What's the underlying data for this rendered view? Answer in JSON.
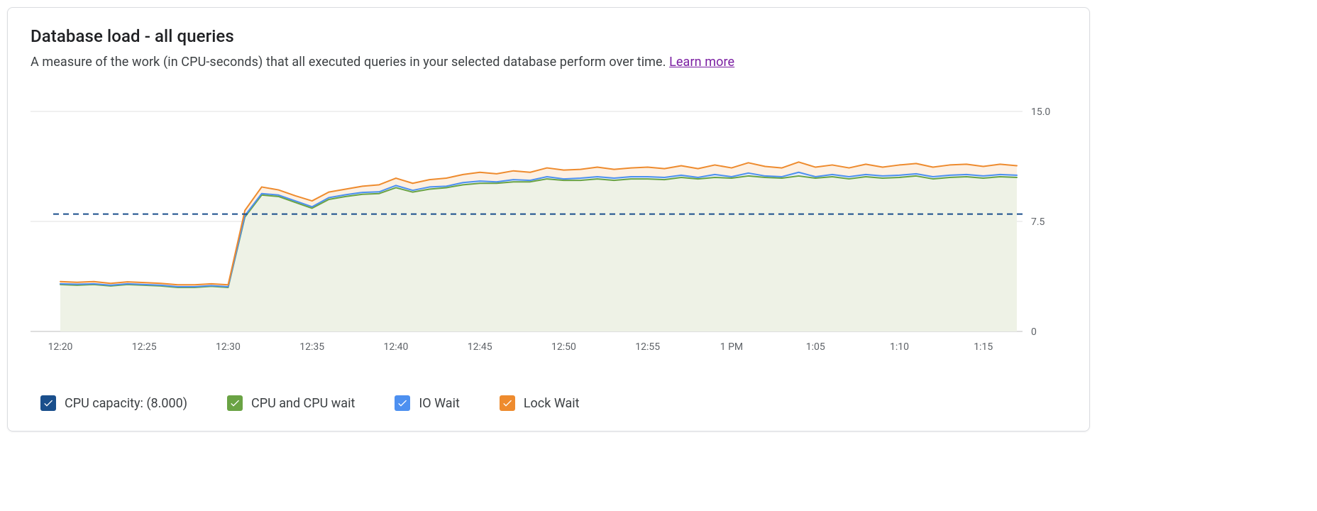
{
  "header": {
    "title": "Database load - all queries",
    "subtitle_pre": "A measure of the work (in CPU-seconds) that all executed queries in your selected database perform over time. ",
    "learn_more": "Learn more"
  },
  "legend": {
    "cpu_capacity": {
      "label": "CPU capacity: (8.000)",
      "color": "#1a4f8c"
    },
    "cpu_wait": {
      "label": "CPU and CPU wait",
      "color": "#6aa344"
    },
    "io_wait": {
      "label": "IO Wait",
      "color": "#4d90f0"
    },
    "lock_wait": {
      "label": "Lock Wait",
      "color": "#ee8b2e"
    }
  },
  "chart_data": {
    "type": "area",
    "ylabel": "",
    "xlabel": "",
    "ylim": [
      0,
      15.0
    ],
    "y_ticks": [
      "0",
      "7.5",
      "15.0"
    ],
    "x_ticks": [
      "12:20",
      "12:25",
      "12:30",
      "12:35",
      "12:40",
      "12:45",
      "12:50",
      "12:55",
      "1 PM",
      "1:05",
      "1:10",
      "1:15"
    ],
    "cpu_capacity_line": 8.0,
    "x": [
      0,
      1,
      2,
      3,
      4,
      5,
      6,
      7,
      8,
      9,
      10,
      11,
      12,
      13,
      14,
      15,
      16,
      17,
      18,
      19,
      20,
      21,
      22,
      23,
      24,
      25,
      26,
      27,
      28,
      29,
      30,
      31,
      32,
      33,
      34,
      35,
      36,
      37,
      38,
      39,
      40,
      41,
      42,
      43,
      44,
      45,
      46,
      47,
      48,
      49,
      50,
      51,
      52,
      53,
      54,
      55,
      56,
      57
    ],
    "series": [
      {
        "name": "CPU and CPU wait",
        "color_line": "#6aa344",
        "color_fill": "#eef2e6",
        "values": [
          3.2,
          3.15,
          3.2,
          3.1,
          3.2,
          3.15,
          3.1,
          3.0,
          3.0,
          3.08,
          3.0,
          7.8,
          9.3,
          9.2,
          8.8,
          8.4,
          9.0,
          9.2,
          9.35,
          9.4,
          9.8,
          9.5,
          9.7,
          9.8,
          10.0,
          10.1,
          10.1,
          10.2,
          10.2,
          10.4,
          10.3,
          10.3,
          10.4,
          10.3,
          10.4,
          10.4,
          10.35,
          10.5,
          10.4,
          10.5,
          10.45,
          10.6,
          10.5,
          10.45,
          10.6,
          10.45,
          10.55,
          10.4,
          10.55,
          10.45,
          10.5,
          10.6,
          10.4,
          10.5,
          10.55,
          10.45,
          10.55,
          10.5
        ]
      },
      {
        "name": "IO Wait",
        "color_line": "#4d90f0",
        "color_fill": "#e6eefb",
        "values": [
          3.25,
          3.22,
          3.25,
          3.15,
          3.25,
          3.2,
          3.15,
          3.05,
          3.05,
          3.12,
          3.05,
          7.9,
          9.4,
          9.3,
          8.9,
          8.5,
          9.12,
          9.32,
          9.48,
          9.52,
          9.95,
          9.62,
          9.85,
          9.9,
          10.15,
          10.25,
          10.2,
          10.35,
          10.3,
          10.55,
          10.4,
          10.45,
          10.55,
          10.45,
          10.55,
          10.55,
          10.5,
          10.65,
          10.5,
          10.7,
          10.55,
          10.8,
          10.6,
          10.55,
          10.85,
          10.55,
          10.7,
          10.55,
          10.7,
          10.6,
          10.65,
          10.75,
          10.55,
          10.65,
          10.7,
          10.6,
          10.7,
          10.65
        ]
      },
      {
        "name": "Lock Wait",
        "color_line": "#ee8b2e",
        "color_fill": "#fdf0e2",
        "values": [
          3.4,
          3.35,
          3.4,
          3.28,
          3.38,
          3.33,
          3.28,
          3.18,
          3.18,
          3.25,
          3.18,
          8.25,
          9.85,
          9.65,
          9.25,
          8.9,
          9.5,
          9.7,
          9.9,
          10.0,
          10.45,
          10.1,
          10.35,
          10.45,
          10.7,
          10.85,
          10.75,
          10.95,
          10.85,
          11.15,
          11.0,
          11.05,
          11.2,
          11.05,
          11.15,
          11.2,
          11.1,
          11.3,
          11.1,
          11.35,
          11.15,
          11.5,
          11.25,
          11.15,
          11.55,
          11.2,
          11.35,
          11.15,
          11.4,
          11.2,
          11.35,
          11.45,
          11.2,
          11.35,
          11.4,
          11.25,
          11.4,
          11.3
        ]
      }
    ]
  }
}
